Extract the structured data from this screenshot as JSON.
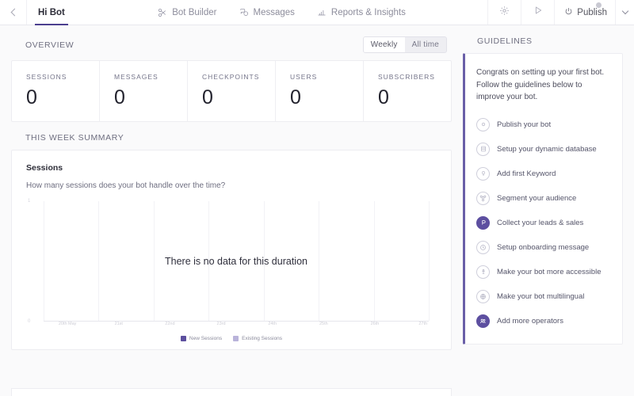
{
  "topbar": {
    "back_icon": "chevron-left-icon",
    "bot_tab": "Hi Bot",
    "nav": [
      {
        "label": "Bot Builder",
        "icon": "bot-builder-icon"
      },
      {
        "label": "Messages",
        "icon": "messages-icon"
      },
      {
        "label": "Reports & Insights",
        "icon": "reports-insights-icon"
      }
    ],
    "settings_icon": "gear-icon",
    "preview_icon": "play-icon",
    "publish_label": "Publish",
    "publish_icon": "power-icon",
    "publish_caret_icon": "chevron-down-icon"
  },
  "overview": {
    "heading": "OVERVIEW",
    "toggle": {
      "options": [
        "Weekly",
        "All time"
      ],
      "selected": "Weekly"
    },
    "stats": [
      {
        "label": "SESSIONS",
        "value": "0"
      },
      {
        "label": "MESSAGES",
        "value": "0"
      },
      {
        "label": "CHECKPOINTS",
        "value": "0"
      },
      {
        "label": "USERS",
        "value": "0"
      },
      {
        "label": "SUBSCRIBERS",
        "value": "0"
      }
    ]
  },
  "summary": {
    "heading": "THIS WEEK SUMMARY",
    "chart_title": "Sessions",
    "chart_subtitle": "How many sessions does your bot handle over the time?",
    "empty_message": "There is no data for this duration"
  },
  "chart_data": {
    "type": "bar",
    "title": "Sessions",
    "subtitle": "How many sessions does your bot handle over the time?",
    "categories": [
      "20th May",
      "21st",
      "22nd",
      "23rd",
      "24th",
      "25th",
      "26th",
      "27th"
    ],
    "series": [
      {
        "name": "New Sessions",
        "color": "#5c4f9e",
        "values": [
          0,
          0,
          0,
          0,
          0,
          0,
          0,
          0
        ]
      },
      {
        "name": "Existing Sessions",
        "color": "#b9b3da",
        "values": [
          0,
          0,
          0,
          0,
          0,
          0,
          0,
          0
        ]
      }
    ],
    "yticks": [
      "1",
      "0"
    ],
    "ylim": [
      0,
      1
    ],
    "xlabel": "",
    "ylabel": "",
    "grid": true,
    "legend_position": "bottom",
    "annotation": "There is no data for this duration"
  },
  "guidelines": {
    "heading": "GUIDELINES",
    "intro": "Congrats on setting up your first bot. Follow the guidelines below to improve your bot.",
    "items": [
      {
        "label": "Publish your bot",
        "icon": "publish-circle-icon",
        "done": false
      },
      {
        "label": "Setup your dynamic database",
        "icon": "database-icon",
        "done": false
      },
      {
        "label": "Add first Keyword",
        "icon": "keyword-icon",
        "done": false
      },
      {
        "label": "Segment your audience",
        "icon": "segment-icon",
        "done": false
      },
      {
        "label": "Collect your leads & sales",
        "icon": "leads-icon",
        "done": true
      },
      {
        "label": "Setup onboarding message",
        "icon": "onboarding-icon",
        "done": false
      },
      {
        "label": "Make your bot more accessible",
        "icon": "accessible-icon",
        "done": false
      },
      {
        "label": "Make your bot multilingual",
        "icon": "multilingual-icon",
        "done": false
      },
      {
        "label": "Add more operators",
        "icon": "operators-icon",
        "done": true
      }
    ]
  },
  "colors": {
    "accent": "#4b3f8f",
    "series_new": "#5c4f9e",
    "series_existing": "#b9b3da",
    "page_bg": "#fafafb"
  }
}
